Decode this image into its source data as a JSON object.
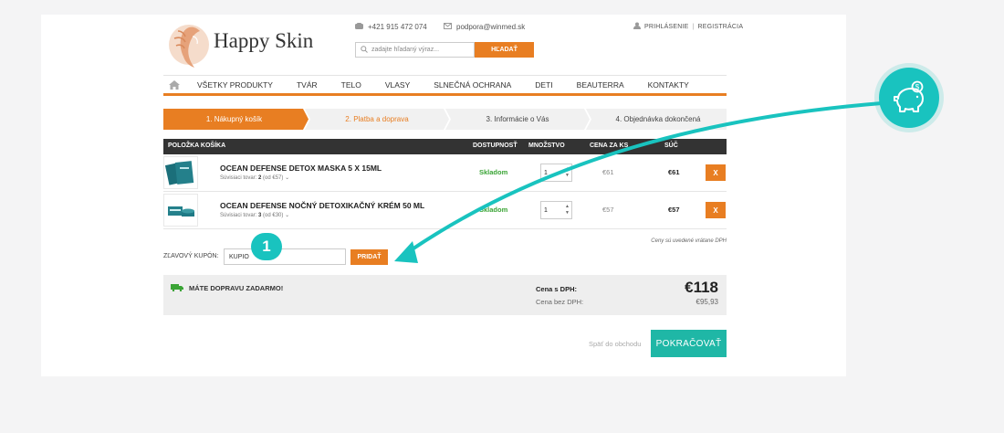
{
  "header": {
    "logo_text": "Happy Skin",
    "phone": "+421 915 472 074",
    "email": "podpora@winmed.sk",
    "login": "PRIHLÁSENIE",
    "register": "REGISTRÁCIA",
    "search_placeholder": "zadajte hľadaný výraz...",
    "search_button": "HĽADAŤ"
  },
  "nav": {
    "items": [
      "VŠETKY PRODUKTY",
      "TVÁR",
      "TELO",
      "VLASY",
      "SLNEČNÁ OCHRANA",
      "DETI",
      "BEAUTERRA",
      "KONTAKTY"
    ]
  },
  "steps": [
    {
      "label": "1. Nákupný košík",
      "state": "active"
    },
    {
      "label": "2. Platba a doprava",
      "state": "next"
    },
    {
      "label": "3. Informácie o Vás",
      "state": "inactive"
    },
    {
      "label": "4. Objednávka dokončená",
      "state": "inactive"
    }
  ],
  "table": {
    "headers": {
      "item": "POLOŽKA KOŠÍKA",
      "availability": "DOSTUPNOSŤ",
      "quantity": "MNOŽSTVO",
      "price": "CENA ZA KS",
      "total": "SÚČ"
    },
    "rows": [
      {
        "name": "OCEAN DEFENSE DETOX MASKA 5 X 15ML",
        "related_label": "Súvisiaci tovar:",
        "related_count": "2",
        "related_from": "(od €57)",
        "stock": "Skladom",
        "qty": "1",
        "price": "€61",
        "total": "€61",
        "remove": "X"
      },
      {
        "name": "OCEAN DEFENSE NOČNÝ DETOXIKAČNÝ KRÉM 50 ML",
        "related_label": "Súvisiaci tovar:",
        "related_count": "3",
        "related_from": "(od €30)",
        "stock": "Skladom",
        "qty": "1",
        "price": "€57",
        "total": "€57",
        "remove": "X"
      }
    ],
    "vat_note": "Ceny sú uvedené vrátane DPH"
  },
  "coupon": {
    "label": "ZĽAVOVÝ KUPÓN:",
    "value": "KUPIO",
    "button": "PRIDAŤ"
  },
  "summary": {
    "shipping": "MÁTE DOPRAVU ZADARMO!",
    "with_vat_label": "Cena s DPH:",
    "without_vat_label": "Cena bez DPH:",
    "with_vat": "€118",
    "without_vat": "€95,93"
  },
  "actions": {
    "back": "Späť do obchodu",
    "continue": "POKRAČOVAŤ"
  },
  "annotation": {
    "badge": "1"
  },
  "colors": {
    "accent": "#e87e22",
    "teal": "#1fb7a6",
    "annotation": "#19c3bf",
    "stock_green": "#3aa435"
  }
}
